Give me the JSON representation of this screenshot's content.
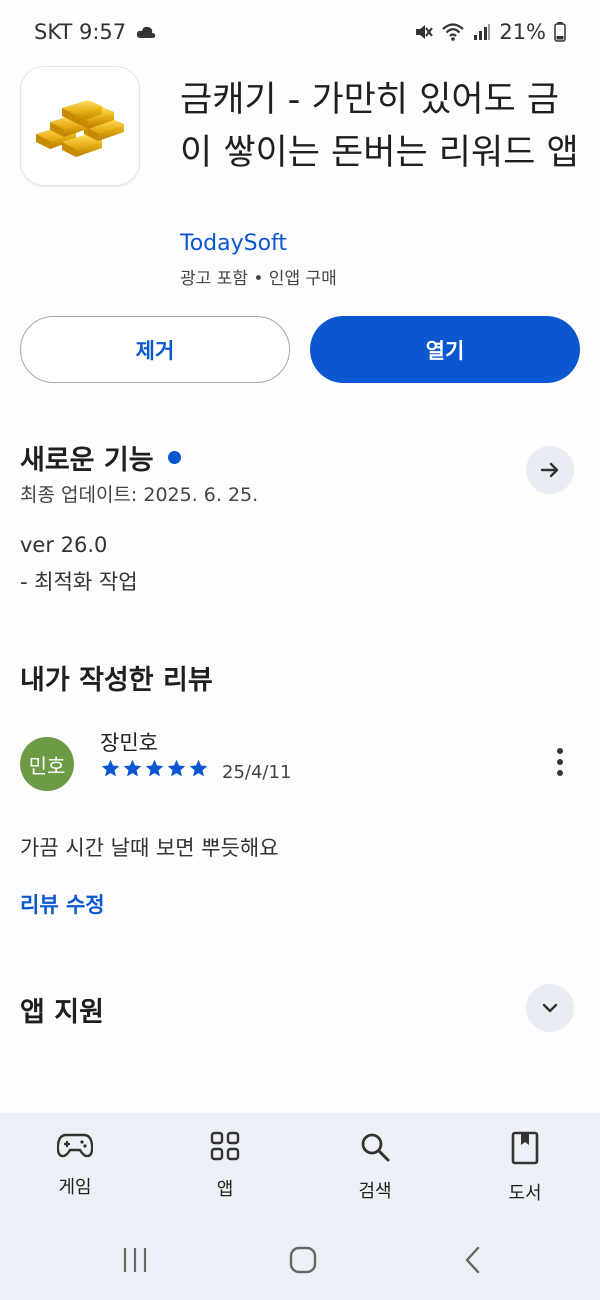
{
  "status_bar": {
    "carrier_time": "SKT 9:57",
    "battery": "21%"
  },
  "app": {
    "title": "금캐기 - 가만히 있어도 금이 쌓이는 돈버는 리워드 앱",
    "developer": "TodaySoft",
    "meta": "광고 포함  •  인앱 구매",
    "icon": "gold-bars-icon"
  },
  "actions": {
    "remove_label": "제거",
    "open_label": "열기"
  },
  "whats_new": {
    "title": "새로운 기능",
    "updated": "최종 업데이트: 2025. 6. 25.",
    "version": "ver 26.0",
    "note": "- 최적화 작업"
  },
  "my_review": {
    "title": "내가 작성한 리뷰",
    "avatar_text": "민호",
    "reviewer": "장민호",
    "rating": 5,
    "date": "25/4/11",
    "text": "가끔 시간 날때 보면 뿌듯해요",
    "edit_label": "리뷰 수정"
  },
  "app_support": {
    "title": "앱 지원"
  },
  "bottom_nav": [
    {
      "label": "게임",
      "icon": "gamepad-icon"
    },
    {
      "label": "앱",
      "icon": "apps-grid-icon"
    },
    {
      "label": "검색",
      "icon": "search-icon"
    },
    {
      "label": "도서",
      "icon": "book-icon"
    }
  ],
  "colors": {
    "accent": "#0b57d0",
    "avatar": "#6d9a45",
    "nav_bg": "#eef0f8"
  }
}
